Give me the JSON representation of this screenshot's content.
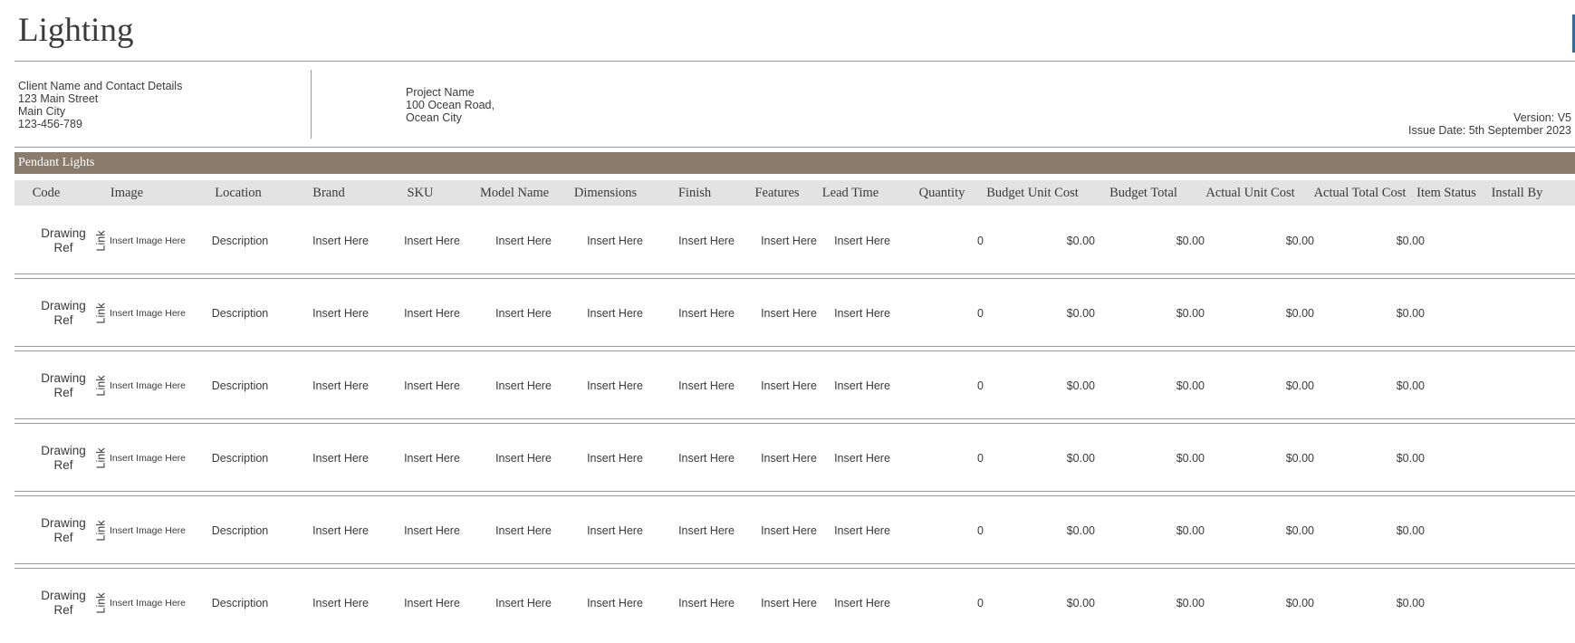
{
  "page": {
    "title": "Lighting"
  },
  "client": {
    "lines": [
      "Client Name and Contact Details",
      "123 Main Street",
      "Main City",
      "123-456-789"
    ]
  },
  "project": {
    "lines": [
      "Project Name",
      "100 Ocean Road,",
      "Ocean City"
    ]
  },
  "meta": {
    "version": "Version: V5",
    "issue_date": "Issue Date: 5th September 2023"
  },
  "section": {
    "title": "Pendant Lights"
  },
  "columns": [
    "Code",
    "Image",
    "Location",
    "Brand",
    "SKU",
    "Model Name",
    "Dimensions",
    "Finish",
    "Features",
    "Lead Time",
    "Quantity",
    "Budget Unit Cost",
    "Budget Total",
    "Actual Unit Cost",
    "Actual Total Cost",
    "Item Status",
    "Install By"
  ],
  "rows": [
    {
      "code": "Drawing Ref",
      "link": "Link",
      "image": "Insert Image Here",
      "location": "Description",
      "brand": "Insert Here",
      "sku": "Insert Here",
      "model": "Insert Here",
      "dimensions": "Insert Here",
      "finish": "Insert Here",
      "features": "Insert Here",
      "lead_time": "Insert Here",
      "quantity": "0",
      "budget_unit": "$0.00",
      "budget_total": "$0.00",
      "actual_unit": "$0.00",
      "actual_total": "$0.00"
    },
    {
      "code": "Drawing Ref",
      "link": "Link",
      "image": "Insert Image Here",
      "location": "Description",
      "brand": "Insert Here",
      "sku": "Insert Here",
      "model": "Insert Here",
      "dimensions": "Insert Here",
      "finish": "Insert Here",
      "features": "Insert Here",
      "lead_time": "Insert Here",
      "quantity": "0",
      "budget_unit": "$0.00",
      "budget_total": "$0.00",
      "actual_unit": "$0.00",
      "actual_total": "$0.00"
    },
    {
      "code": "Drawing Ref",
      "link": "Link",
      "image": "Insert Image Here",
      "location": "Description",
      "brand": "Insert Here",
      "sku": "Insert Here",
      "model": "Insert Here",
      "dimensions": "Insert Here",
      "finish": "Insert Here",
      "features": "Insert Here",
      "lead_time": "Insert Here",
      "quantity": "0",
      "budget_unit": "$0.00",
      "budget_total": "$0.00",
      "actual_unit": "$0.00",
      "actual_total": "$0.00"
    },
    {
      "code": "Drawing Ref",
      "link": "Link",
      "image": "Insert Image Here",
      "location": "Description",
      "brand": "Insert Here",
      "sku": "Insert Here",
      "model": "Insert Here",
      "dimensions": "Insert Here",
      "finish": "Insert Here",
      "features": "Insert Here",
      "lead_time": "Insert Here",
      "quantity": "0",
      "budget_unit": "$0.00",
      "budget_total": "$0.00",
      "actual_unit": "$0.00",
      "actual_total": "$0.00"
    },
    {
      "code": "Drawing Ref",
      "link": "Link",
      "image": "Insert Image Here",
      "location": "Description",
      "brand": "Insert Here",
      "sku": "Insert Here",
      "model": "Insert Here",
      "dimensions": "Insert Here",
      "finish": "Insert Here",
      "features": "Insert Here",
      "lead_time": "Insert Here",
      "quantity": "0",
      "budget_unit": "$0.00",
      "budget_total": "$0.00",
      "actual_unit": "$0.00",
      "actual_total": "$0.00"
    },
    {
      "code": "Drawing Ref",
      "link": "Link",
      "image": "Insert Image Here",
      "location": "Description",
      "brand": "Insert Here",
      "sku": "Insert Here",
      "model": "Insert Here",
      "dimensions": "Insert Here",
      "finish": "Insert Here",
      "features": "Insert Here",
      "lead_time": "Insert Here",
      "quantity": "0",
      "budget_unit": "$0.00",
      "budget_total": "$0.00",
      "actual_unit": "$0.00",
      "actual_total": "$0.00"
    }
  ],
  "colors": {
    "section_bar": "#8b7b6b",
    "header_bg": "#e3e3e3",
    "accent": "#2e6da4"
  }
}
